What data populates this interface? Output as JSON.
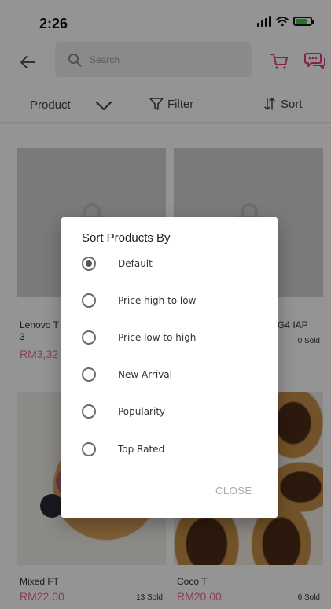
{
  "status_bar": {
    "time": "2:26"
  },
  "app_bar": {
    "search_placeholder": "Search"
  },
  "filter_bar": {
    "product_label": "Product",
    "filter_label": "Filter",
    "sort_label": "Sort"
  },
  "products": [
    {
      "name": "Lenovo T\n3",
      "price": "RM3,32",
      "sold": ""
    },
    {
      "name": "G4 IAP",
      "price": "",
      "sold": "0 Sold"
    },
    {
      "name": "Mixed FT",
      "price": "RM22.00",
      "sold": "13 Sold"
    },
    {
      "name": "Coco T",
      "price": "RM20.00",
      "sold": "6 Sold"
    }
  ],
  "dialog": {
    "title": "Sort Products By",
    "options": [
      {
        "label": "Default",
        "selected": true
      },
      {
        "label": "Price high to low",
        "selected": false
      },
      {
        "label": "Price low to high",
        "selected": false
      },
      {
        "label": "New Arrival",
        "selected": false
      },
      {
        "label": "Popularity",
        "selected": false
      },
      {
        "label": "Top Rated",
        "selected": false
      }
    ],
    "close_label": "CLOSE"
  },
  "colors": {
    "accent": "#e0407f",
    "price": "#e86aa4",
    "battery": "#43c24a"
  }
}
